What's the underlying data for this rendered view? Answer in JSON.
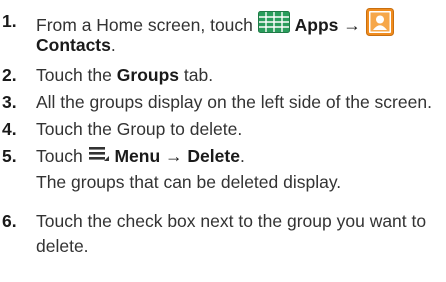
{
  "steps": [
    {
      "num": "1.",
      "pre": "From a Home screen, touch",
      "apps_label": "Apps",
      "arrow": "→",
      "contacts_label": "Contacts",
      "post": ".",
      "icons": [
        "apps-grid-icon",
        "contacts-icon"
      ]
    },
    {
      "num": "2.",
      "pre": "Touch the",
      "bold": "Groups",
      "post": "tab."
    },
    {
      "num": "3.",
      "text": "All the groups display on the left side of the screen."
    },
    {
      "num": "4.",
      "text": "Touch the Group to delete."
    },
    {
      "num": "5.",
      "pre": "Touch",
      "menu_label": "Menu",
      "arrow": "→",
      "delete_label": "Delete",
      "post": ".",
      "note": "The groups that can be deleted display.",
      "icons": [
        "menu-icon"
      ]
    },
    {
      "num": "6.",
      "line1": "Touch the check box next to the group you want to",
      "line2": "delete."
    }
  ],
  "colors": {
    "text": "#333333",
    "bold": "#1a1a1a",
    "apps_icon": "#2a9d5c",
    "contacts_icon": "#f08c1e"
  }
}
